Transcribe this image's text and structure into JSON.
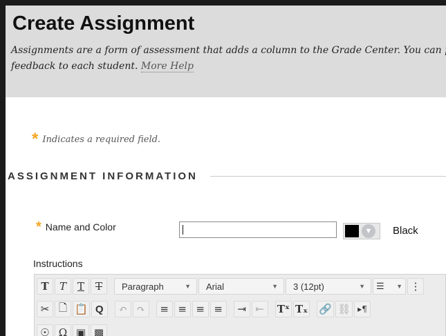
{
  "header": {
    "title": "Create Assignment",
    "description": "Assignments are a form of assessment that adds a column to the Grade Center. You can provide feedback to each student.",
    "more_help": "More Help"
  },
  "required_note": {
    "star": "*",
    "text": "Indicates a required field."
  },
  "section": {
    "title": "ASSIGNMENT INFORMATION"
  },
  "name_field": {
    "star": "*",
    "label": "Name and Color",
    "value": "",
    "color_name": "Black",
    "color_hex": "#000000"
  },
  "instructions": {
    "label": "Instructions"
  },
  "toolbar": {
    "row1": {
      "format_buttons": [
        {
          "name": "bold-icon",
          "glyph": "T"
        },
        {
          "name": "italic-icon",
          "glyph": "T"
        },
        {
          "name": "underline-icon",
          "glyph": "T"
        },
        {
          "name": "strikethrough-icon",
          "glyph": "T"
        }
      ],
      "paragraph_select": "Paragraph",
      "font_select": "Arial",
      "size_select": "3 (12pt)",
      "list_glyph": "☰"
    },
    "row2": {
      "edit_buttons": [
        {
          "name": "cut-icon",
          "glyph": "✂"
        },
        {
          "name": "copy-icon",
          "glyph": "🗋"
        },
        {
          "name": "paste-icon",
          "glyph": "📋"
        },
        {
          "name": "find-icon",
          "glyph": "Q"
        }
      ],
      "history_buttons": [
        {
          "name": "undo-icon",
          "glyph": "↶"
        },
        {
          "name": "redo-icon",
          "glyph": "↷"
        }
      ],
      "align_buttons": [
        {
          "name": "align-left-icon",
          "glyph": "≡"
        },
        {
          "name": "align-center-icon",
          "glyph": "≡"
        },
        {
          "name": "align-right-icon",
          "glyph": "≡"
        },
        {
          "name": "align-justify-icon",
          "glyph": "≡"
        }
      ],
      "indent_buttons": [
        {
          "name": "indent-icon",
          "glyph": "⇥"
        },
        {
          "name": "outdent-icon",
          "glyph": "⇤"
        }
      ],
      "script_buttons": [
        {
          "name": "superscript-icon",
          "glyph": "Tˣ"
        },
        {
          "name": "subscript-icon",
          "glyph": "Tₓ"
        }
      ],
      "link_buttons": [
        {
          "name": "link-icon",
          "glyph": "🔗"
        },
        {
          "name": "unlink-icon",
          "glyph": "⛓"
        }
      ],
      "extra_glyph": "▸¶"
    }
  },
  "colors": {
    "header_bg": "#dcdcdc",
    "required_star": "#f5a623",
    "frame": "#1b1b1b"
  }
}
